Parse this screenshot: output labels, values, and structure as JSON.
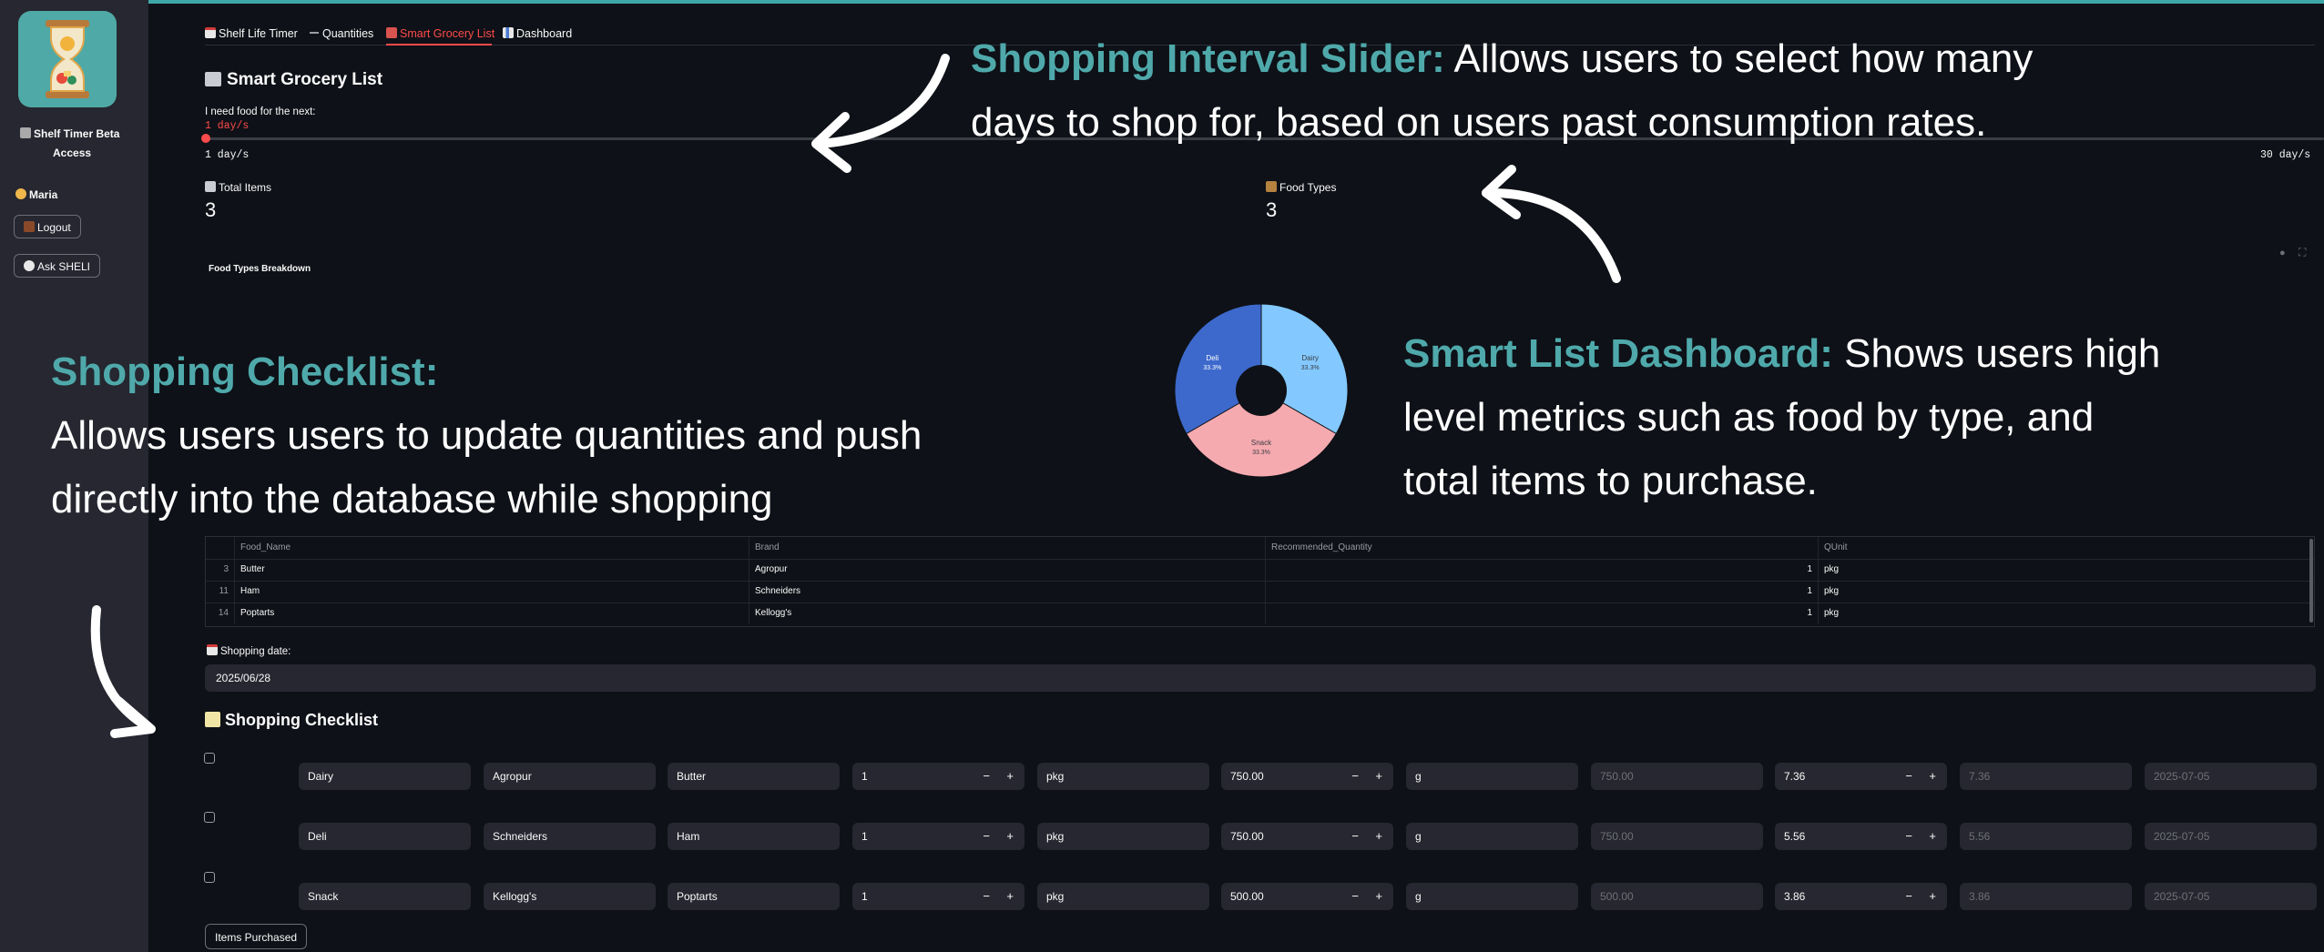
{
  "sidebar": {
    "app_title_line1": "Shelf Timer Beta",
    "app_title_line2": "Access",
    "user_name": "Maria",
    "logout_label": "Logout",
    "ask_label": "Ask SHELI",
    "logo_icon": "hourglass-icon"
  },
  "tabs": [
    {
      "label": "Shelf Life Timer",
      "icon": "calendar-icon"
    },
    {
      "label": "Quantities",
      "icon": "minus-icon"
    },
    {
      "label": "Smart Grocery List",
      "icon": "cart-icon",
      "active": true
    },
    {
      "label": "Dashboard",
      "icon": "bar-chart-icon"
    }
  ],
  "page": {
    "title": "Smart Grocery List",
    "slider_label": "I need food for the next:",
    "slider_value": "1 day/s",
    "slider_min": "1 day/s",
    "slider_max": "30 day/s",
    "slider_fraction": 0.0
  },
  "metrics": {
    "total_items_label": "Total Items",
    "total_items_value": "3",
    "food_types_label": "Food Types",
    "food_types_value": "3"
  },
  "chart_title": "Food Types Breakdown",
  "chart_data": {
    "type": "pie",
    "title": "Food Types Breakdown",
    "hole": true,
    "slices": [
      {
        "label": "Dairy",
        "value": 33.3,
        "display": "33.3%",
        "color": "#83c9ff"
      },
      {
        "label": "Snack",
        "value": 33.3,
        "display": "33.3%",
        "color": "#f5aaaf"
      },
      {
        "label": "Deli",
        "value": 33.3,
        "display": "33.3%",
        "color": "#3d69cc"
      }
    ]
  },
  "table": {
    "columns": [
      "Food_Name",
      "Brand",
      "Recommended_Quantity",
      "QUnit"
    ],
    "rows": [
      {
        "index": "3",
        "food": "Butter",
        "brand": "Agropur",
        "qty": "1",
        "unit": "pkg"
      },
      {
        "index": "11",
        "food": "Ham",
        "brand": "Schneiders",
        "qty": "1",
        "unit": "pkg"
      },
      {
        "index": "14",
        "food": "Poptarts",
        "brand": "Kellogg's",
        "qty": "1",
        "unit": "pkg"
      }
    ]
  },
  "shopping_date": {
    "label": "Shopping date:",
    "value": "2025/06/28"
  },
  "checklist": {
    "title": "Shopping Checklist",
    "rows": [
      {
        "type": "Dairy",
        "brand": "Agropur",
        "name": "Butter",
        "qty": "1",
        "unit": "pkg",
        "size": "750.00",
        "size_unit": "g",
        "size_disp": "750.00",
        "price": "7.36",
        "price_disp": "7.36",
        "date": "2025-07-05"
      },
      {
        "type": "Deli",
        "brand": "Schneiders",
        "name": "Ham",
        "qty": "1",
        "unit": "pkg",
        "size": "750.00",
        "size_unit": "g",
        "size_disp": "750.00",
        "price": "5.56",
        "price_disp": "5.56",
        "date": "2025-07-05"
      },
      {
        "type": "Snack",
        "brand": "Kellogg's",
        "name": "Poptarts",
        "qty": "1",
        "unit": "pkg",
        "size": "500.00",
        "size_unit": "g",
        "size_disp": "500.00",
        "price": "3.86",
        "price_disp": "3.86",
        "date": "2025-07-05"
      }
    ],
    "submit_label": "Items Purchased"
  },
  "annotations": {
    "slider_title": "Shopping Interval Slider:",
    "slider_line1": " Allows users to select how many",
    "slider_line2": "days to shop for, based on users past consumption rates.",
    "checklist_title": "Shopping Checklist:",
    "checklist_line1": "Allows users users to update quantities and push",
    "checklist_line2": "directly into the database while shopping",
    "dashboard_title": "Smart List Dashboard:",
    "dashboard_line1": " Shows users high",
    "dashboard_line2": "level metrics such as food by type, and",
    "dashboard_line3": "total items to purchase."
  },
  "colors": {
    "background": "#0e1117",
    "sidebar": "#262730",
    "accent_red": "#ff4b4b",
    "annotation_teal": "#4fa9ab"
  }
}
